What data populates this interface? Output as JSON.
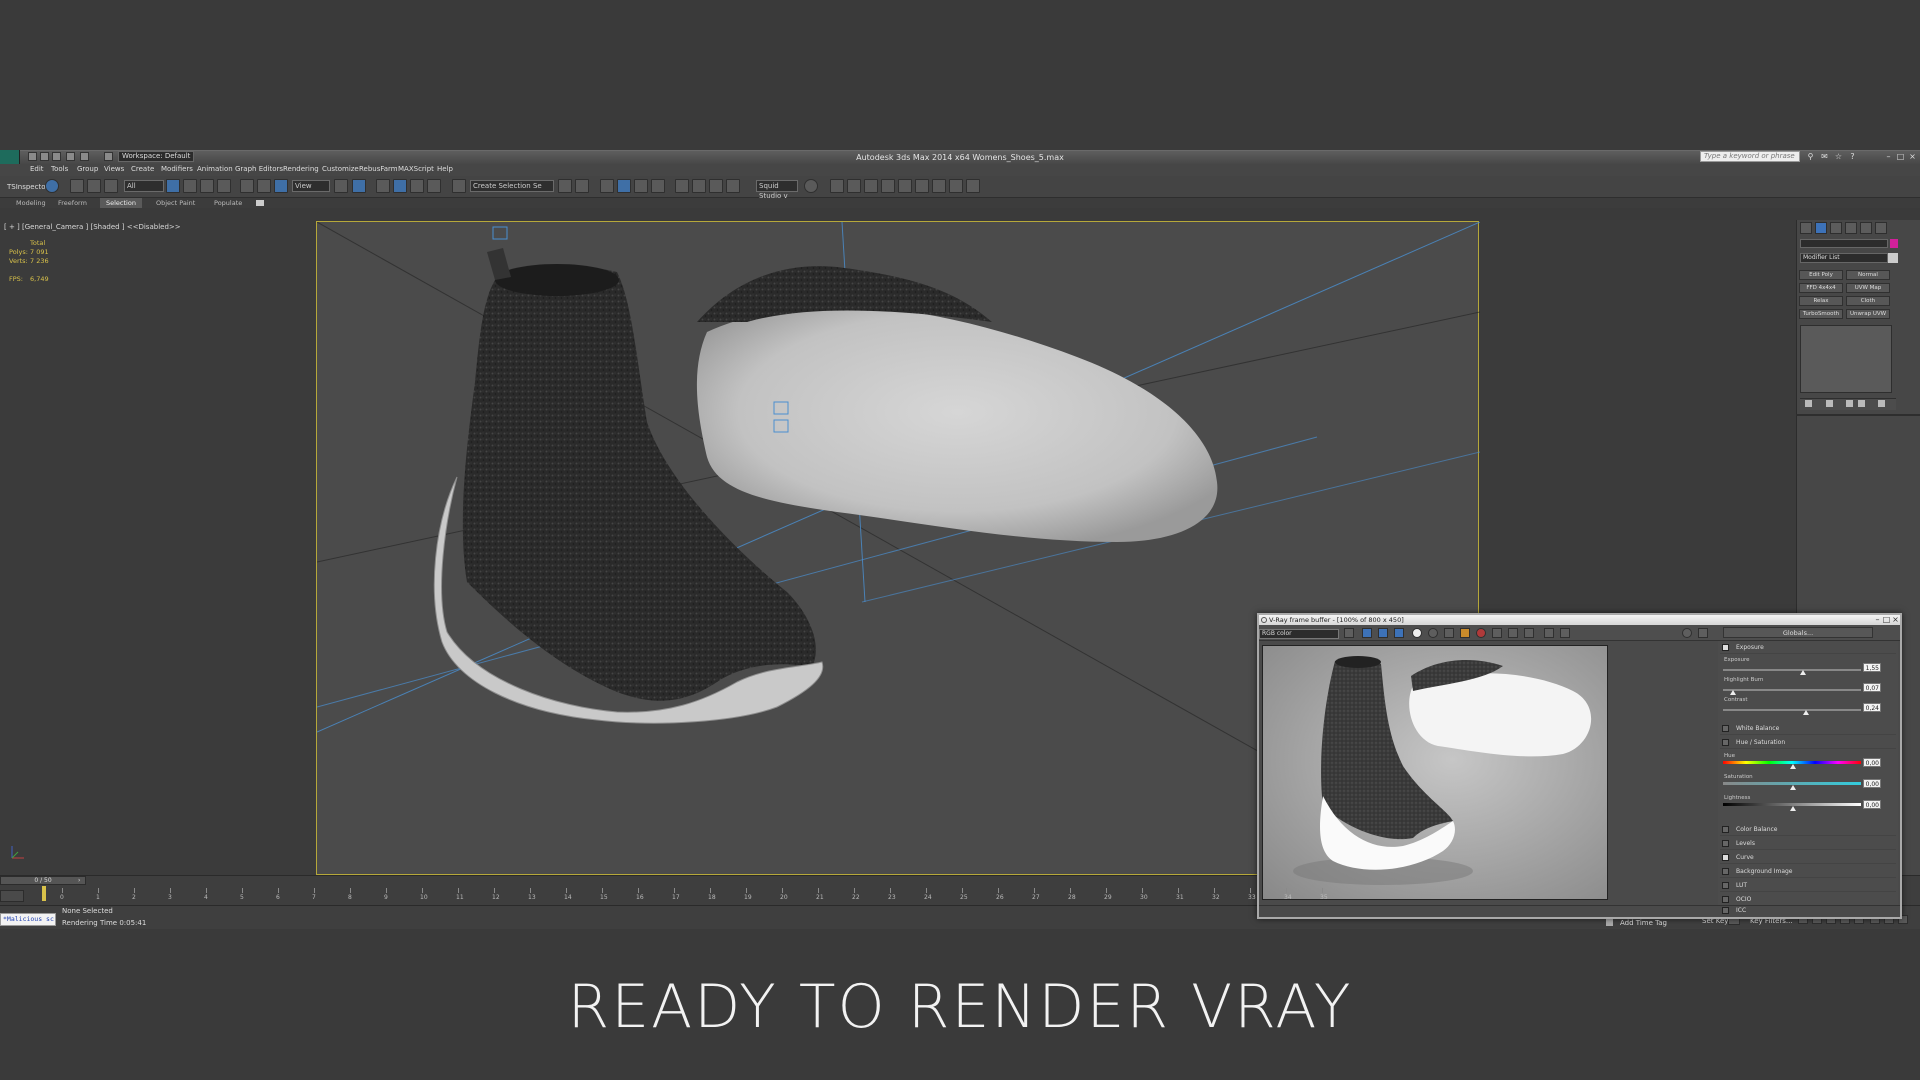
{
  "title_bar": {
    "workspace": "Workspace: Default",
    "app_title": "Autodesk 3ds Max  2014 x64     Womens_Shoes_5.max",
    "search_placeholder": "Type a keyword or phrase"
  },
  "menu": [
    "Edit",
    "Tools",
    "Group",
    "Views",
    "Create",
    "Modifiers",
    "Animation",
    "Graph Editors",
    "Rendering",
    "Customize",
    "RebusFarm",
    "MAXScript",
    "Help"
  ],
  "toolbar": {
    "tsinspector": "TSInspector",
    "filter": "All",
    "view": "View",
    "selection_set": "Create Selection Se",
    "script_label": "Squid Studio v"
  },
  "ribbon_tabs": [
    "Modeling",
    "Freeform",
    "Selection",
    "Object Paint",
    "Populate"
  ],
  "ribbon_active": "Selection",
  "viewport": {
    "label": "[ + ] [General_Camera ] [Shaded ]  <<Disabled>>",
    "stats": {
      "total_label": "Total",
      "polys_label": "Polys:",
      "polys_value": "7 091",
      "verts_label": "Verts:",
      "verts_value": "7 236",
      "fps_label": "FPS:",
      "fps_value": "6,749"
    }
  },
  "command_panel": {
    "modifier_list": "Modifier List",
    "buttons": [
      "Edit Poly",
      "Normal",
      "FFD 4x4x4",
      "UVW Map",
      "Relax",
      "Cloth",
      "TurboSmooth",
      "Unwrap UVW"
    ]
  },
  "timeline": {
    "slider": "0 / 50",
    "ticks": [
      "0",
      "1",
      "2",
      "3",
      "4",
      "5",
      "6",
      "7",
      "8",
      "9",
      "10",
      "11",
      "12",
      "13",
      "14",
      "15",
      "16",
      "17",
      "18",
      "19",
      "20",
      "21",
      "22",
      "23",
      "24",
      "25",
      "26",
      "27",
      "28",
      "29",
      "30",
      "31",
      "32",
      "33",
      "34",
      "35"
    ]
  },
  "status_bar": {
    "maxscript": "*Malicious sc",
    "selection": "None Selected",
    "render_time": "Rendering Time  0:05:41",
    "add_time_tag": "Add Time Tag",
    "set_key": "Set Key",
    "key_filters": "Key Filters..."
  },
  "vfb": {
    "title": "V-Ray frame buffer - [100% of 800 x 450]",
    "channel": "RGB color",
    "globals": "Globals...",
    "exposure": {
      "label": "Exposure",
      "exposure_label": "Exposure",
      "exposure_value": "1,55",
      "exposure_level": 0.58,
      "highlight_label": "Highlight Burn",
      "highlight_value": "0,07",
      "highlight_level": 0.07,
      "contrast_label": "Contrast",
      "contrast_value": "0,24",
      "contrast_level": 0.6
    },
    "white_balance": "White Balance",
    "hue": {
      "label": "Hue / Saturation",
      "hue_label": "Hue",
      "hue_value": "0,00",
      "saturation_label": "Saturation",
      "saturation_value": "0,00",
      "lightness_label": "Lightness",
      "lightness_value": "0,00"
    },
    "sections": [
      "Color Balance",
      "Levels",
      "Curve",
      "Background Image",
      "LUT",
      "OCIO",
      "ICC"
    ]
  },
  "caption": "READY TO RENDER VRAY",
  "colors": {
    "viewport_border": "#b6a83a",
    "stats": "#d9c24a",
    "accent_blue": "#3d72b8"
  }
}
